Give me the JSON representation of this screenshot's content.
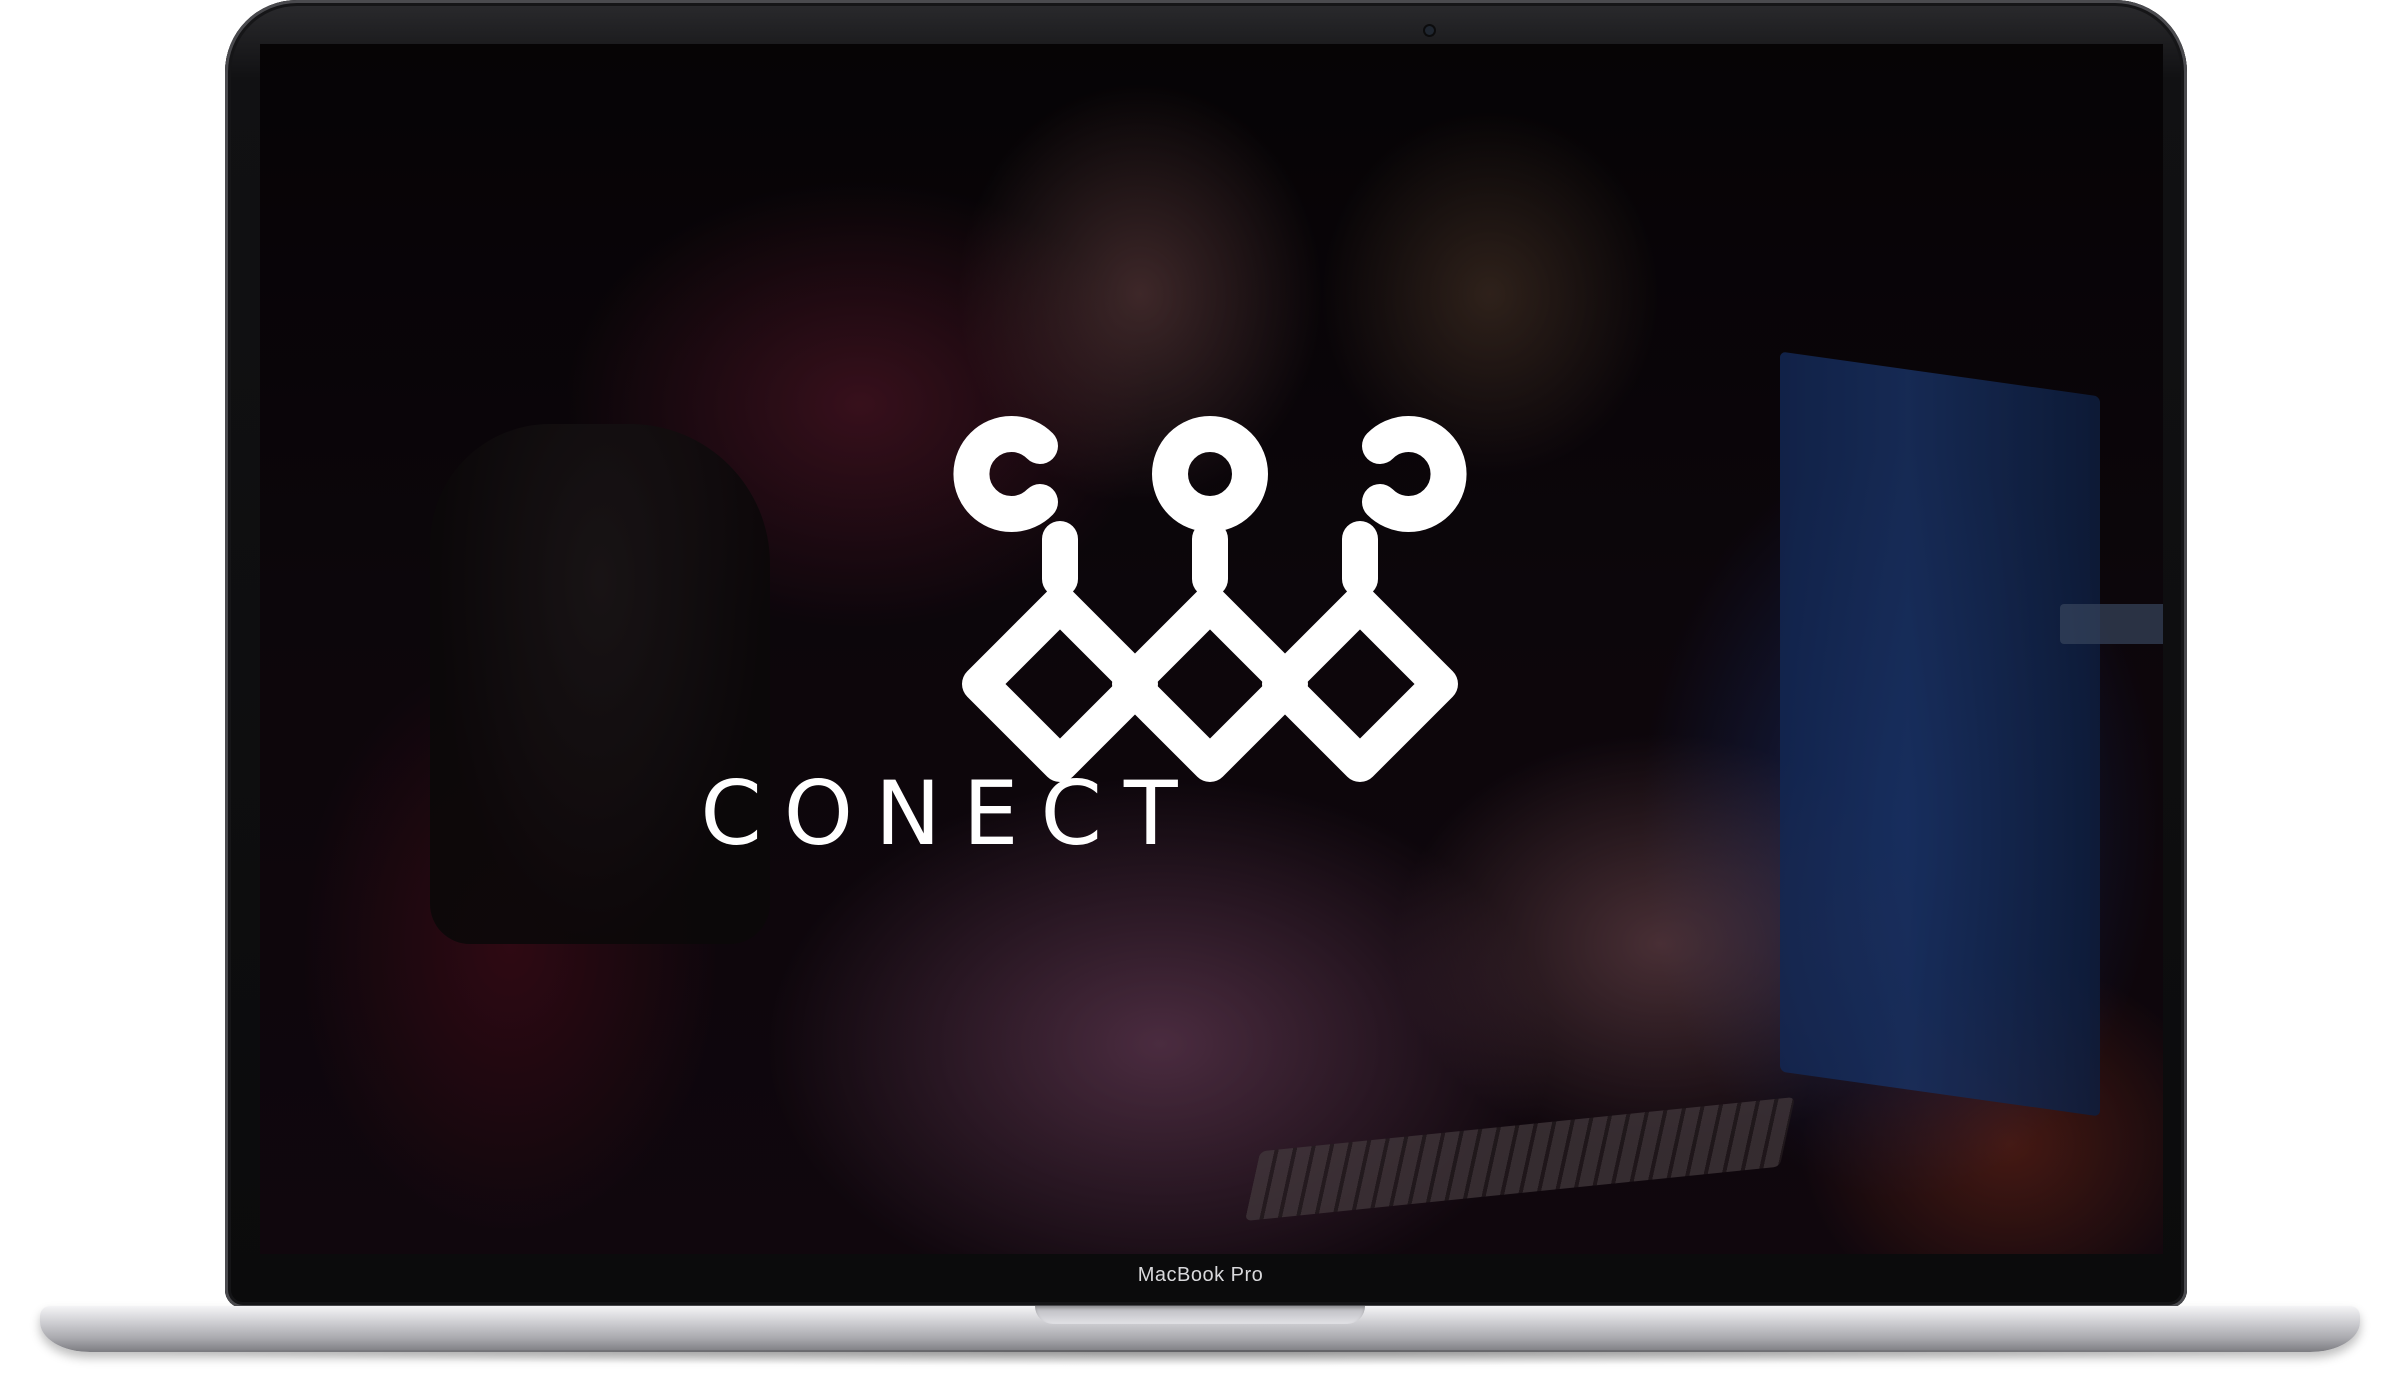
{
  "device": {
    "model_label": "MacBook Pro"
  },
  "screen": {
    "brand_name": "CONECT",
    "logo_icon": "conect-logo-icon",
    "background_image": "friends-gaming-photo",
    "colors": {
      "logo": "#ffffff",
      "bezel": "#0b0b0c",
      "base": "#c9c9cd"
    }
  }
}
